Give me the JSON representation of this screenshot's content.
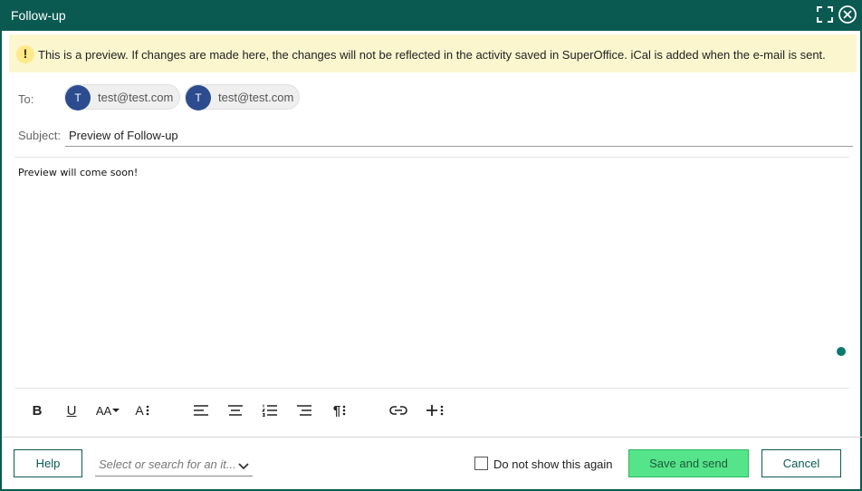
{
  "window": {
    "title": "Follow-up",
    "header_color": "#0b5a52"
  },
  "banner": {
    "icon": "exclamation-icon",
    "text": "This is a preview. If changes are made here, the changes will not be reflected in the activity saved in SuperOffice. iCal is added when the e-mail is sent."
  },
  "to": {
    "label": "To:",
    "recipients": [
      {
        "initial": "T",
        "email": "test@test.com"
      },
      {
        "initial": "T",
        "email": "test@test.com"
      }
    ]
  },
  "subject": {
    "label": "Subject:",
    "value": "Preview of Follow-up"
  },
  "body": {
    "text": "Preview will come soon!"
  },
  "toolbar": {
    "icons": [
      "bold-icon",
      "underline-icon",
      "font-size-icon",
      "text-style-icon",
      "align-left-icon",
      "align-center-icon",
      "numbered-list-icon",
      "align-right-icon",
      "paragraph-icon",
      "link-icon",
      "insert-icon"
    ],
    "bold": "B",
    "underline": "U",
    "font_size": "AA",
    "text_style": "A"
  },
  "footer": {
    "help_label": "Help",
    "select_placeholder": "Select or search for an it...",
    "checkbox_label": "Do not show this again",
    "checkbox_checked": false,
    "save_label": "Save and send",
    "cancel_label": "Cancel"
  },
  "colors": {
    "accent": "#0b5a52",
    "avatar": "#2c4c8f",
    "primary_button": "#55e48a",
    "banner_bg": "#fcf6cf"
  }
}
